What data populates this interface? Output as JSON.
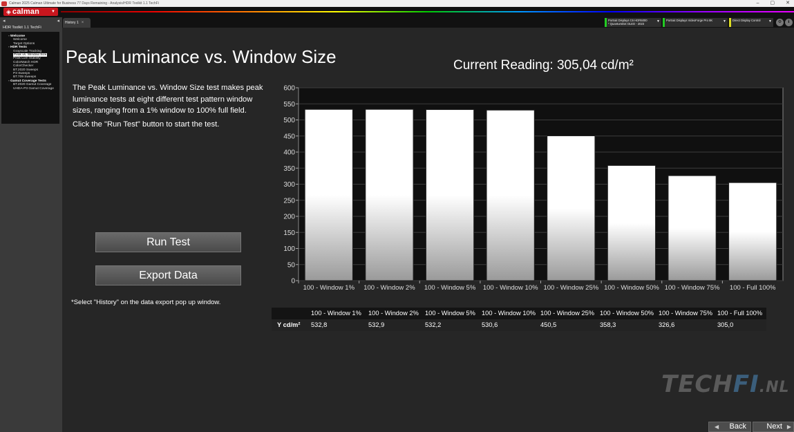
{
  "window": {
    "title": "Calman 2025 Calman Ultimate for Business 77 Days Remaining - Analysis/HDR Toolkit 1.1 TechFi",
    "controls": [
      "–",
      "▢",
      "✕"
    ]
  },
  "header": {
    "logo": "calman"
  },
  "sidebar": {
    "title": "HDR Toolkit 1.1 TechFi",
    "items": [
      {
        "label": "Welcome",
        "level": 0
      },
      {
        "label": "Welcome",
        "level": 1
      },
      {
        "label": "Target Options",
        "level": 1
      },
      {
        "label": "HDR Tests",
        "level": 0
      },
      {
        "label": "Grayscale Tracking",
        "level": 1
      },
      {
        "label": "Peak vs. Window Size",
        "level": 1,
        "selected": true
      },
      {
        "label": "Peak Lum Stability",
        "level": 1
      },
      {
        "label": "ColorMatch HDR",
        "level": 1
      },
      {
        "label": "ColorChecker",
        "level": 1
      },
      {
        "label": "BT.2020 Sweeps",
        "level": 1
      },
      {
        "label": "P3 Sweeps",
        "level": 1
      },
      {
        "label": "BT.709 Sweeps",
        "level": 1
      },
      {
        "label": "Gamut Coverage Tests",
        "level": 0
      },
      {
        "label": "BT.2020 Gamut Coverage",
        "level": 1
      },
      {
        "label": "UHDA-P3 Gamut Coverage",
        "level": 1
      }
    ]
  },
  "tabs": [
    {
      "label": "History 1"
    }
  ],
  "devices": {
    "source": {
      "line1": "Portrait Displays C6 HDR5000",
      "line2": "* QuantumDot OLED - 2023",
      "color": "#22cc22"
    },
    "generator": {
      "line1": "Portrait Displays VideoForge Pro 8K",
      "line2": "",
      "color": "#22cc22"
    },
    "display": {
      "line1": "Direct Display Control",
      "line2": "",
      "color": "#dddd22"
    }
  },
  "main": {
    "title": "Peak Luminance vs. Window Size",
    "current_reading": "Current Reading: 305,04 cd/m²",
    "description": "The Peak Luminance vs. Window Size test makes peak luminance tests at eight different test pattern window sizes, ranging from a 1% window to 100% full field.",
    "instruction": "Click the \"Run Test\" button to start the test.",
    "run_button": "Run Test",
    "export_button": "Export  Data",
    "note": "*Select \"History\" on the data export pop up window.",
    "watermark_a": "TECH",
    "watermark_b": "FI",
    "watermark_c": ".NL",
    "back_button": "Back",
    "next_button": "Next"
  },
  "table": {
    "row_label": "Y cd/m²",
    "columns": [
      "100 - Window  1%",
      "100 - Window  2%",
      "100 - Window  5%",
      "100 - Window 10%",
      "100 - Window 25%",
      "100 - Window 50%",
      "100 - Window 75%",
      "100 - Full  100%"
    ],
    "values": [
      "532,8",
      "532,9",
      "532,2",
      "530,6",
      "450,5",
      "358,3",
      "326,6",
      "305,0"
    ]
  },
  "chart_data": {
    "type": "bar",
    "categories": [
      "100 - Window  1%",
      "100 - Window  2%",
      "100 - Window  5%",
      "100 - Window 10%",
      "100 - Window 25%",
      "100 - Window 50%",
      "100 - Window 75%",
      "100 - Full  100%"
    ],
    "values": [
      532.8,
      532.9,
      532.2,
      530.6,
      450.5,
      358.3,
      326.6,
      305.0
    ],
    "ylim": [
      0,
      600
    ],
    "yticks": [
      0,
      50,
      100,
      150,
      200,
      250,
      300,
      350,
      400,
      450,
      500,
      550,
      600
    ],
    "grid": true,
    "bar_color": "#ffffff",
    "background": "#101010"
  }
}
